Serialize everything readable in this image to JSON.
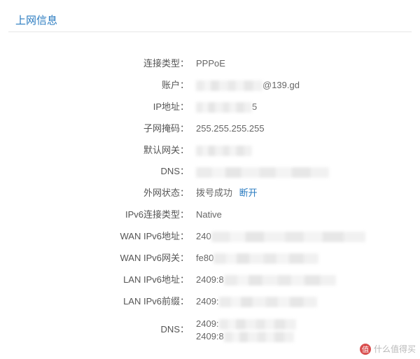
{
  "header": {
    "title": "上网信息"
  },
  "rows": {
    "conn_type": {
      "label": "连接类型：",
      "value": "PPPoE"
    },
    "account": {
      "label": "账户：",
      "suffix": "@139.gd"
    },
    "ip": {
      "label": "IP地址：",
      "suffix": "5"
    },
    "mask": {
      "label": "子网掩码：",
      "value": "255.255.255.255"
    },
    "gateway": {
      "label": "默认网关："
    },
    "dns": {
      "label": "DNS："
    },
    "wan_status": {
      "label": "外网状态：",
      "value": "拨号成功",
      "link": "断开"
    },
    "ipv6_type": {
      "label": "IPv6连接类型：",
      "value": "Native"
    },
    "wan_ipv6": {
      "label": "WAN IPv6地址：",
      "prefix": "240"
    },
    "wan_ipv6_gw": {
      "label": "WAN IPv6网关：",
      "prefix": "fe80"
    },
    "lan_ipv6": {
      "label": "LAN IPv6地址：",
      "prefix": "2409:8"
    },
    "lan_ipv6_pfx": {
      "label": "LAN IPv6前缀：",
      "prefix": "2409:"
    },
    "dns6": {
      "label": "DNS：",
      "prefix1": "2409:",
      "prefix2": "2409:8"
    }
  },
  "watermark": {
    "chip": "值",
    "text": "什么值得买"
  }
}
